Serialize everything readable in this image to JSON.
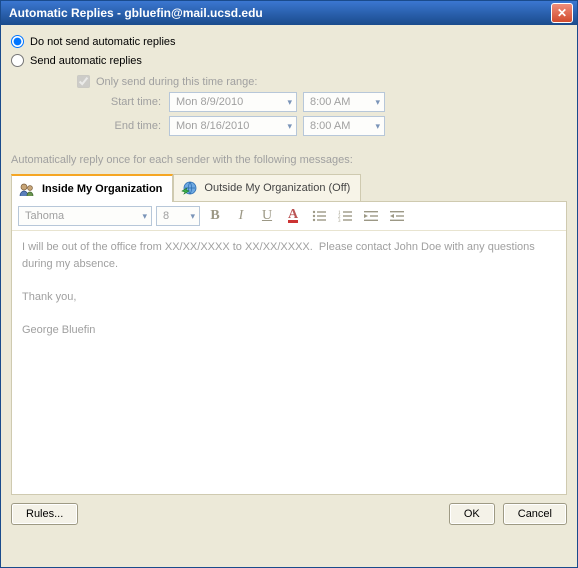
{
  "window": {
    "title": "Automatic Replies - gbluefin@mail.ucsd.edu"
  },
  "options": {
    "dont_send_label": "Do not send automatic replies",
    "send_label": "Send automatic replies",
    "selected": "dont_send",
    "only_send_label": "Only send during this time range:",
    "only_send_checked": true,
    "start_label": "Start time:",
    "start_date": "Mon 8/9/2010",
    "start_time": "8:00 AM",
    "end_label": "End time:",
    "end_date": "Mon 8/16/2010",
    "end_time": "8:00 AM"
  },
  "section_label": "Automatically reply once for each sender with the following messages:",
  "tabs": {
    "inside": "Inside My Organization",
    "outside": "Outside My Organization (Off)",
    "active": "inside"
  },
  "editor": {
    "font_name": "Tahoma",
    "font_size": "8",
    "body": "I will be out of the office from XX/XX/XXXX to XX/XX/XXXX.  Please contact John Doe with any questions during my absence.\n\nThank you,\n\nGeorge Bluefin"
  },
  "buttons": {
    "rules": "Rules...",
    "ok": "OK",
    "cancel": "Cancel"
  }
}
